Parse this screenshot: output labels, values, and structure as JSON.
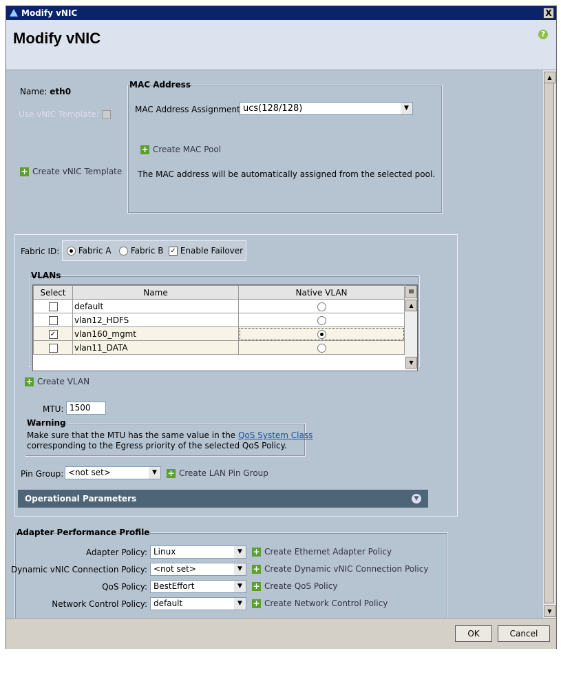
{
  "window": {
    "title": "Modify vNIC",
    "close": "X"
  },
  "header": {
    "title": "Modify vNIC",
    "help": "?"
  },
  "name": {
    "label": "Name:",
    "value": "eth0"
  },
  "use_template": {
    "label": "Use vNIC Template:"
  },
  "create_vnic_template": "Create vNIC Template",
  "mac": {
    "legend": "MAC Address",
    "assignment_label": "MAC Address Assignment:",
    "assignment_value": "ucs(128/128)",
    "create_pool": "Create MAC Pool",
    "info": "The MAC address will be automatically assigned from the selected pool."
  },
  "fabric": {
    "label": "Fabric ID:",
    "a": "Fabric A",
    "b": "Fabric B",
    "failover": "Enable Failover",
    "selected": "Fabric A",
    "failover_checked": true
  },
  "vlans": {
    "legend": "VLANs",
    "columns": [
      "Select",
      "Name",
      "Native VLAN"
    ],
    "rows": [
      {
        "name": "default",
        "selected": false,
        "native": false
      },
      {
        "name": "vlan12_HDFS",
        "selected": false,
        "native": false
      },
      {
        "name": "vlan160_mgmt",
        "selected": true,
        "native": true
      },
      {
        "name": "vlan11_DATA",
        "selected": false,
        "native": false
      }
    ]
  },
  "create_vlan": "Create VLAN",
  "mtu": {
    "label": "MTU:",
    "value": "1500"
  },
  "warning": {
    "legend": "Warning",
    "text1": "Make sure that the MTU has the same value in the ",
    "link": "QoS System Class",
    "text2": "corresponding to the Egress priority of the selected QoS Policy."
  },
  "pin_group": {
    "label": "Pin Group:",
    "value": "<not set>",
    "create": "Create LAN Pin Group"
  },
  "operational": "Operational Parameters",
  "adapter": {
    "legend": "Adapter Performance Profile",
    "rows": [
      {
        "label": "Adapter Policy:",
        "value": "Linux",
        "create": "Create Ethernet Adapter Policy"
      },
      {
        "label": "Dynamic vNIC Connection Policy:",
        "value": "<not set>",
        "create": "Create Dynamic vNIC Connection Policy"
      },
      {
        "label": "QoS Policy:",
        "value": "BestEffort",
        "create": "Create QoS Policy"
      },
      {
        "label": "Network Control Policy:",
        "value": "default",
        "create": "Create Network Control Policy"
      }
    ]
  },
  "footer": {
    "ok": "OK",
    "cancel": "Cancel"
  }
}
